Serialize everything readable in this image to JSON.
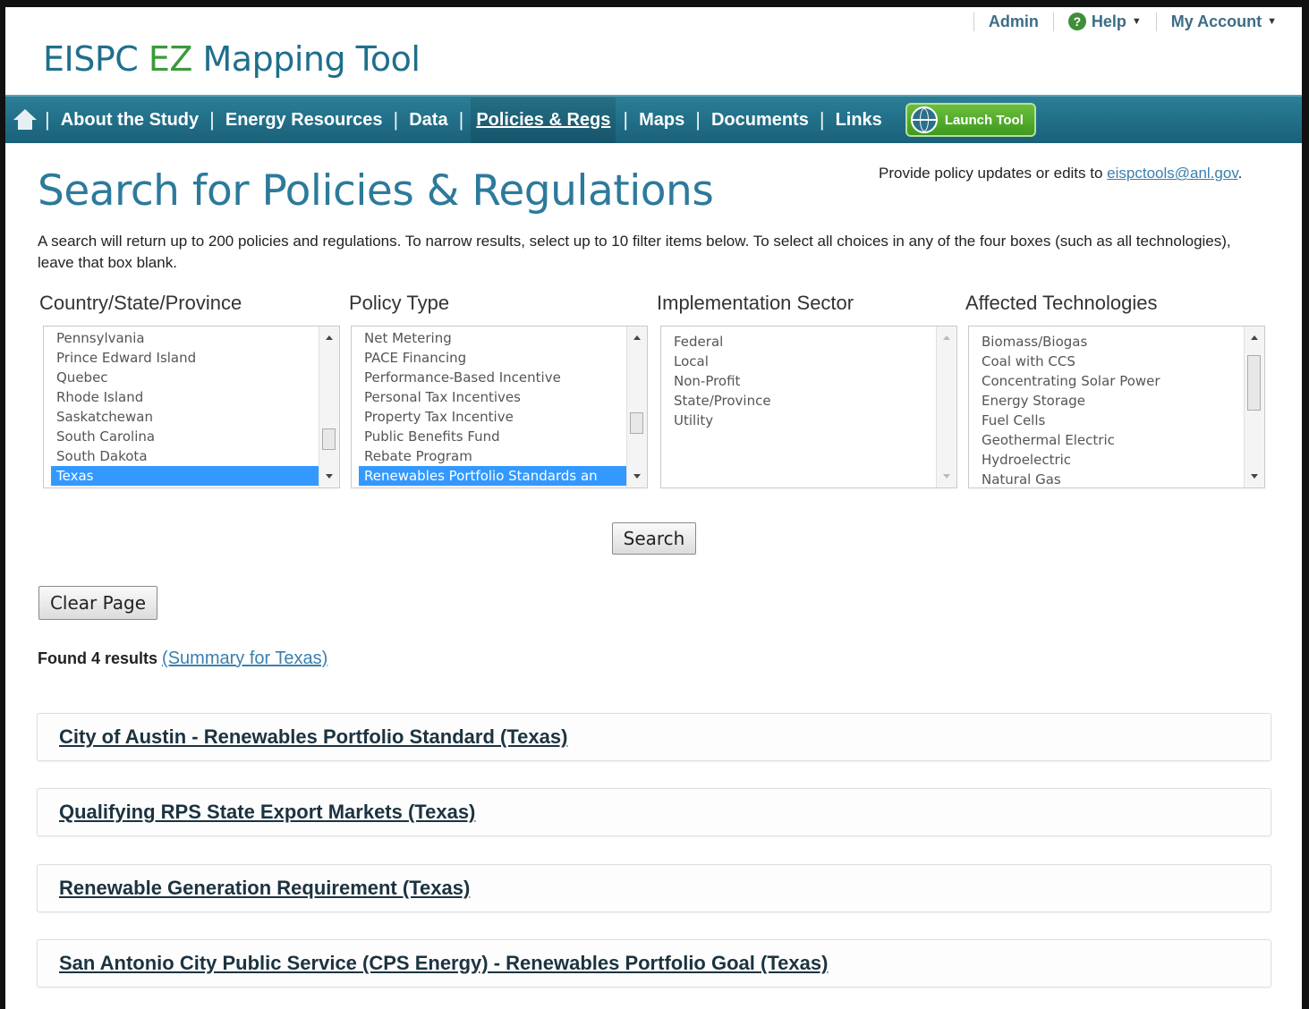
{
  "util_nav": {
    "admin": "Admin",
    "help": "Help",
    "account": "My Account"
  },
  "logo": {
    "part1": "EISPC ",
    "part2": "EZ",
    "part3": " Mapping Tool"
  },
  "nav": {
    "items": [
      "About the Study",
      "Energy Resources",
      "Data",
      "Policies & Regs",
      "Maps",
      "Documents",
      "Links"
    ],
    "active": "Policies & Regs",
    "launch_label": "Launch Tool"
  },
  "page": {
    "title": "Search for Policies & Regulations",
    "provide_text": "Provide policy updates or edits to ",
    "provide_email": "eispctools@anl.gov",
    "provide_end": ".",
    "intro": "A search will return up to 200 policies and regulations. To narrow results, select up to 10 filter items below. To select all choices in any of the four boxes (such as all technologies), leave that box blank."
  },
  "filters": {
    "country": {
      "label": "Country/State/Province",
      "options": [
        "Pennsylvania",
        "Prince Edward Island",
        "Quebec",
        "Rhode Island",
        "Saskatchewan",
        "South Carolina",
        "South Dakota",
        "Texas"
      ],
      "selected": "Texas"
    },
    "policy": {
      "label": "Policy Type",
      "options": [
        "Net Metering",
        "PACE Financing",
        "Performance-Based Incentive",
        "Personal Tax Incentives",
        "Property Tax Incentive",
        "Public Benefits Fund",
        "Rebate Program",
        "Renewables Portfolio Standards an"
      ],
      "selected": "Renewables Portfolio Standards an"
    },
    "sector": {
      "label": "Implementation Sector",
      "options": [
        "Federal",
        "Local",
        "Non-Profit",
        "State/Province",
        "Utility"
      ]
    },
    "tech": {
      "label": "Affected Technologies",
      "options": [
        "Biomass/Biogas",
        "Coal with CCS",
        "Concentrating Solar Power",
        "Energy Storage",
        "Fuel Cells",
        "Geothermal Electric",
        "Hydroelectric",
        "Natural Gas"
      ]
    }
  },
  "buttons": {
    "search": "Search",
    "clear": "Clear Page"
  },
  "results": {
    "found_text": "Found 4 results",
    "summary_link": "(Summary for Texas)",
    "items": [
      "City of Austin - Renewables Portfolio Standard (Texas)",
      "Qualifying RPS State Export Markets (Texas)",
      "Renewable Generation Requirement (Texas)",
      "San Antonio City Public Service (CPS Energy) - Renewables Portfolio Goal (Texas)"
    ]
  }
}
